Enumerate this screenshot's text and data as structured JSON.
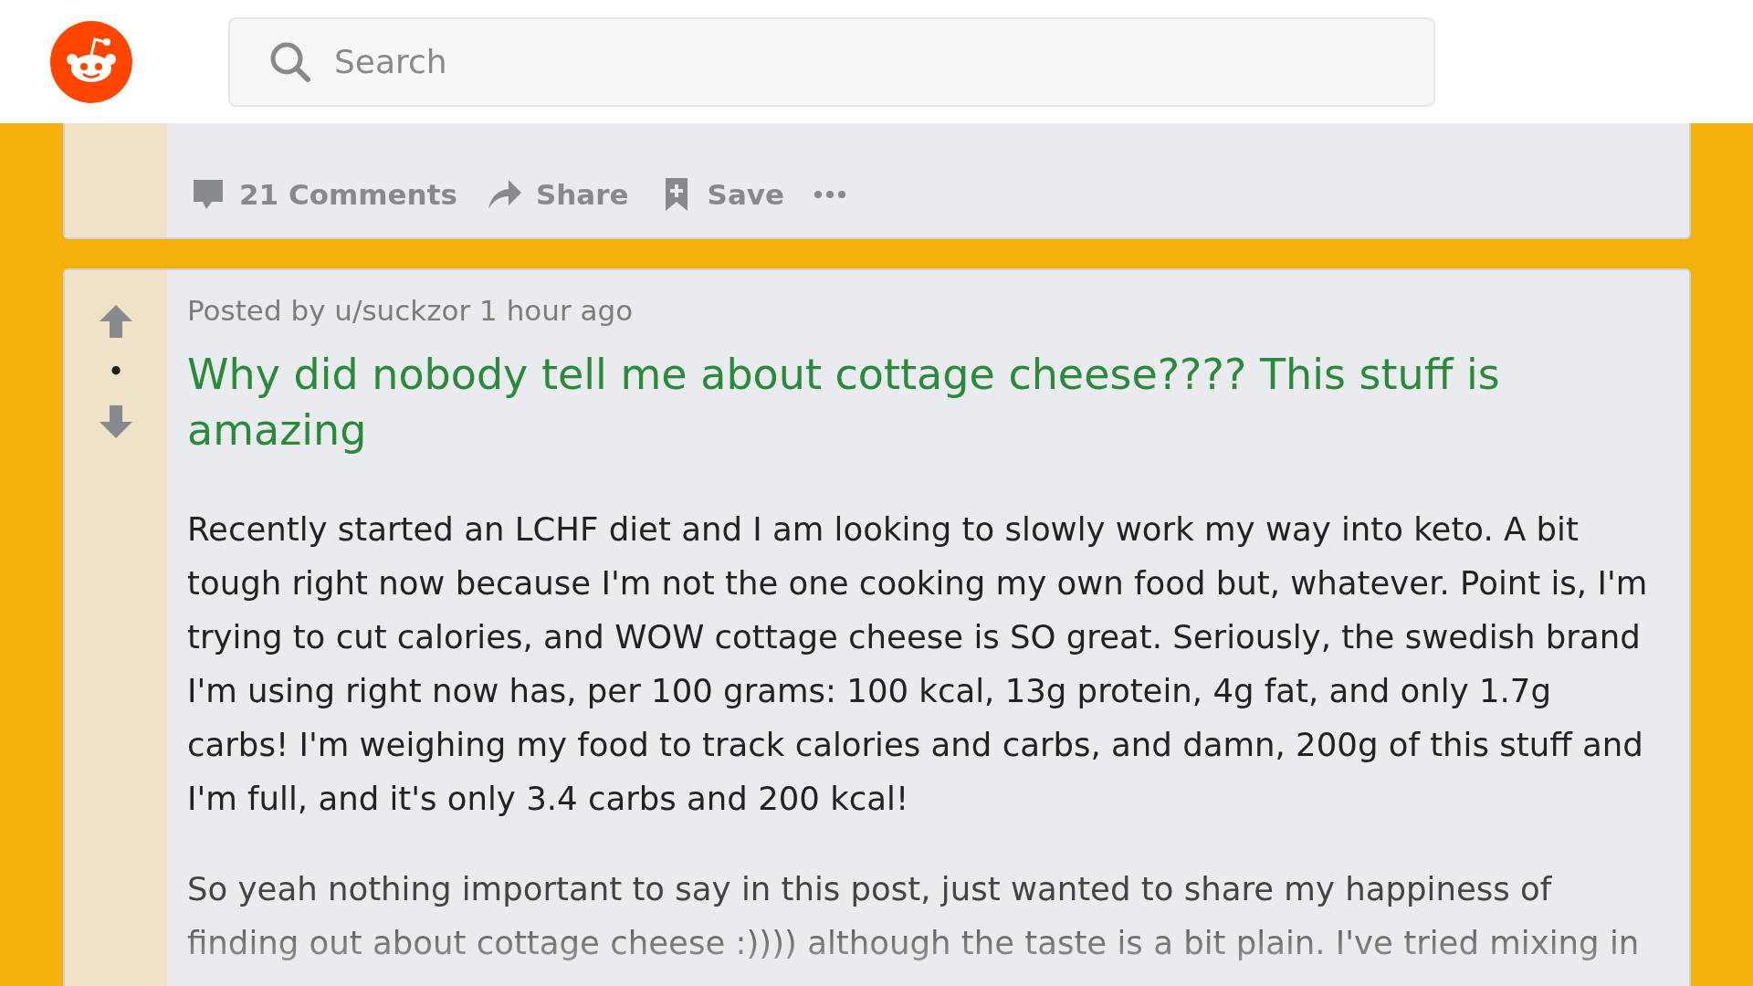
{
  "search": {
    "placeholder": "Search"
  },
  "previous_post": {
    "actions": [
      {
        "kind": "comments",
        "label": "21 Comments"
      },
      {
        "kind": "share",
        "label": "Share"
      },
      {
        "kind": "save",
        "label": "Save"
      },
      {
        "kind": "more"
      }
    ]
  },
  "post": {
    "score": "•",
    "byline": "Posted by u/suckzor 1 hour ago",
    "title": "Why did nobody tell me about cottage cheese???? This stuff is amazing",
    "paragraphs": [
      "Recently started an LCHF diet and I am looking to slowly work my way into keto. A bit tough right now because I'm not the one cooking my own food but, whatever. Point is, I'm trying to cut calories, and WOW cottage cheese is SO great. Seriously, the swedish brand I'm using right now has, per 100 grams: 100 kcal, 13g protein, 4g fat, and only 1.7g carbs! I'm weighing my food to track calories and carbs, and damn, 200g of this stuff and I'm full, and it's only 3.4 carbs and 200 kcal!",
      "So yeah nothing important to say in this post, just wanted to share my happiness of finding out about cottage cheese :)))) although the taste is a bit plain. I've tried mixing in"
    ]
  }
}
